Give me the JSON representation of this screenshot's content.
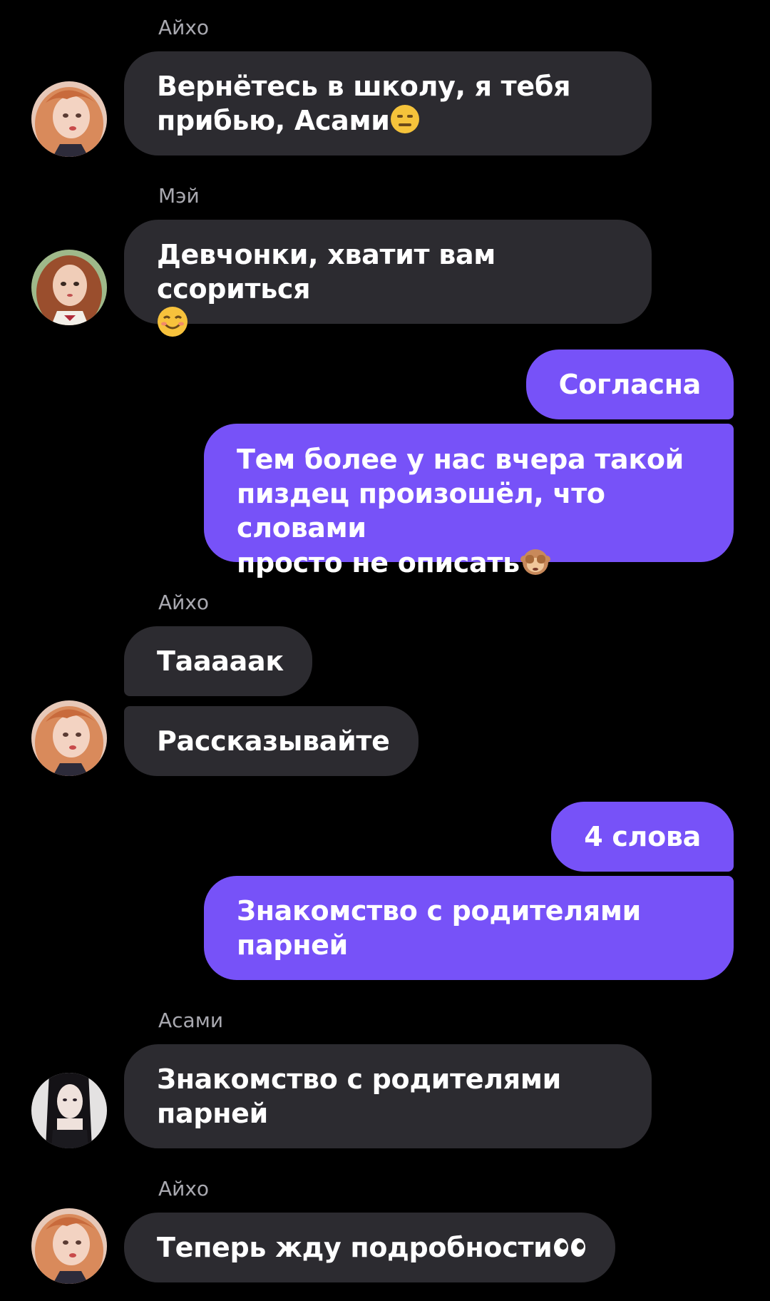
{
  "theme": {
    "background": "#000000",
    "incoming_bubble": "#2c2b30",
    "outgoing_bubble": "#7752f8",
    "sender_name_color": "#a9a9b0",
    "text_color": "#ffffff"
  },
  "messages": [
    {
      "direction": "incoming",
      "sender": "Айхо",
      "avatar": "aiho-avatar",
      "text": "Вернётесь в школу, я тебя\nприбью, Асами",
      "emoji": "expressionless-face-emoji"
    },
    {
      "direction": "incoming",
      "sender": "Мэй",
      "avatar": "mei-avatar",
      "text": "Девчонки, хватит вам ссориться\n",
      "emoji": "smiling-face-emoji"
    },
    {
      "direction": "outgoing",
      "text": "Согласна"
    },
    {
      "direction": "outgoing",
      "text": "Тем более у нас вчера такой\nпиздец произошёл, что словами\nпросто не описать",
      "emoji": "see-no-evil-monkey-emoji"
    },
    {
      "direction": "incoming",
      "sender": "Айхо",
      "text": "Тааааак"
    },
    {
      "direction": "incoming",
      "avatar": "aiho-avatar",
      "text": "Рассказывайте"
    },
    {
      "direction": "outgoing",
      "text": "4 слова"
    },
    {
      "direction": "outgoing",
      "text": "Знакомство с родителями\nпарней"
    },
    {
      "direction": "incoming",
      "sender": "Асами",
      "avatar": "asami-avatar",
      "text": "Знакомство с родителями\nпарней"
    },
    {
      "direction": "incoming",
      "sender": "Айхо",
      "avatar": "aiho-avatar",
      "text": "Теперь жду подробности",
      "emoji": "eyes-emoji"
    }
  ]
}
